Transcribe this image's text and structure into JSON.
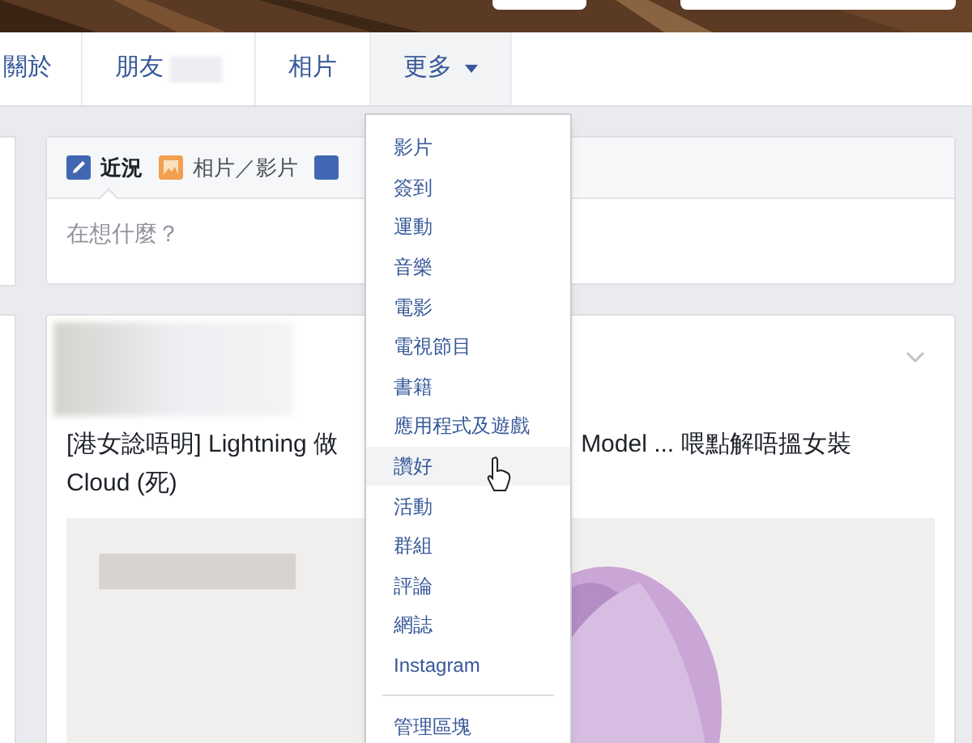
{
  "nav": {
    "tabs": [
      {
        "label": "關於",
        "selected": false
      },
      {
        "label": "朋友",
        "selected": false,
        "blurred_count": true
      },
      {
        "label": "相片",
        "selected": false
      },
      {
        "label": "更多",
        "selected": true,
        "dropdown": true
      }
    ]
  },
  "composer": {
    "tabs": [
      {
        "kind": "status",
        "label": "近況",
        "selected": true
      },
      {
        "label": "相片／影片",
        "selected": false
      },
      {
        "kind": "more",
        "selected": false
      }
    ],
    "placeholder": "在想什麼？"
  },
  "post": {
    "lines": [
      [
        "[港女諗唔明] Lightning 做",
        "Model ... 喂點解唔搵女裝"
      ],
      [
        "Cloud (死)"
      ]
    ]
  },
  "menu": {
    "items": [
      {
        "label": "影片",
        "highlighted": false
      },
      {
        "label": "簽到",
        "highlighted": false
      },
      {
        "label": "運動",
        "highlighted": false
      },
      {
        "label": "音樂",
        "highlighted": false
      },
      {
        "label": "電影",
        "highlighted": false
      },
      {
        "label": "電視節目",
        "highlighted": false
      },
      {
        "label": "書籍",
        "highlighted": false
      },
      {
        "label": "應用程式及遊戲",
        "highlighted": false
      },
      {
        "label": "讚好",
        "highlighted": true
      },
      {
        "label": "活動",
        "highlighted": false
      },
      {
        "label": "群組",
        "highlighted": false
      },
      {
        "label": "評論",
        "highlighted": false
      },
      {
        "label": "網誌",
        "highlighted": false
      },
      {
        "label": "Instagram",
        "highlighted": false
      }
    ],
    "footer_items": [
      {
        "label": "管理區塊"
      }
    ]
  }
}
